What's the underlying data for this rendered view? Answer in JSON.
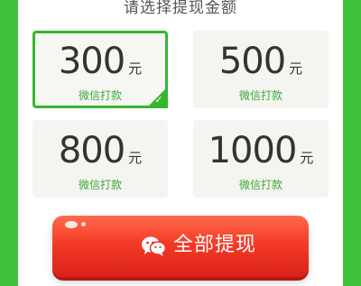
{
  "header": {
    "title": "请选择提现金额"
  },
  "options": [
    {
      "amount": "300",
      "unit": "元",
      "method": "微信打款",
      "selected": true
    },
    {
      "amount": "500",
      "unit": "元",
      "method": "微信打款",
      "selected": false
    },
    {
      "amount": "800",
      "unit": "元",
      "method": "微信打款",
      "selected": false
    },
    {
      "amount": "1000",
      "unit": "元",
      "method": "微信打款",
      "selected": false
    }
  ],
  "withdraw_button": {
    "label": "全部提现",
    "icon": "wechat-icon"
  },
  "colors": {
    "accent": "#35b62f",
    "button": "#f43b25",
    "background": "#3ec23a"
  }
}
